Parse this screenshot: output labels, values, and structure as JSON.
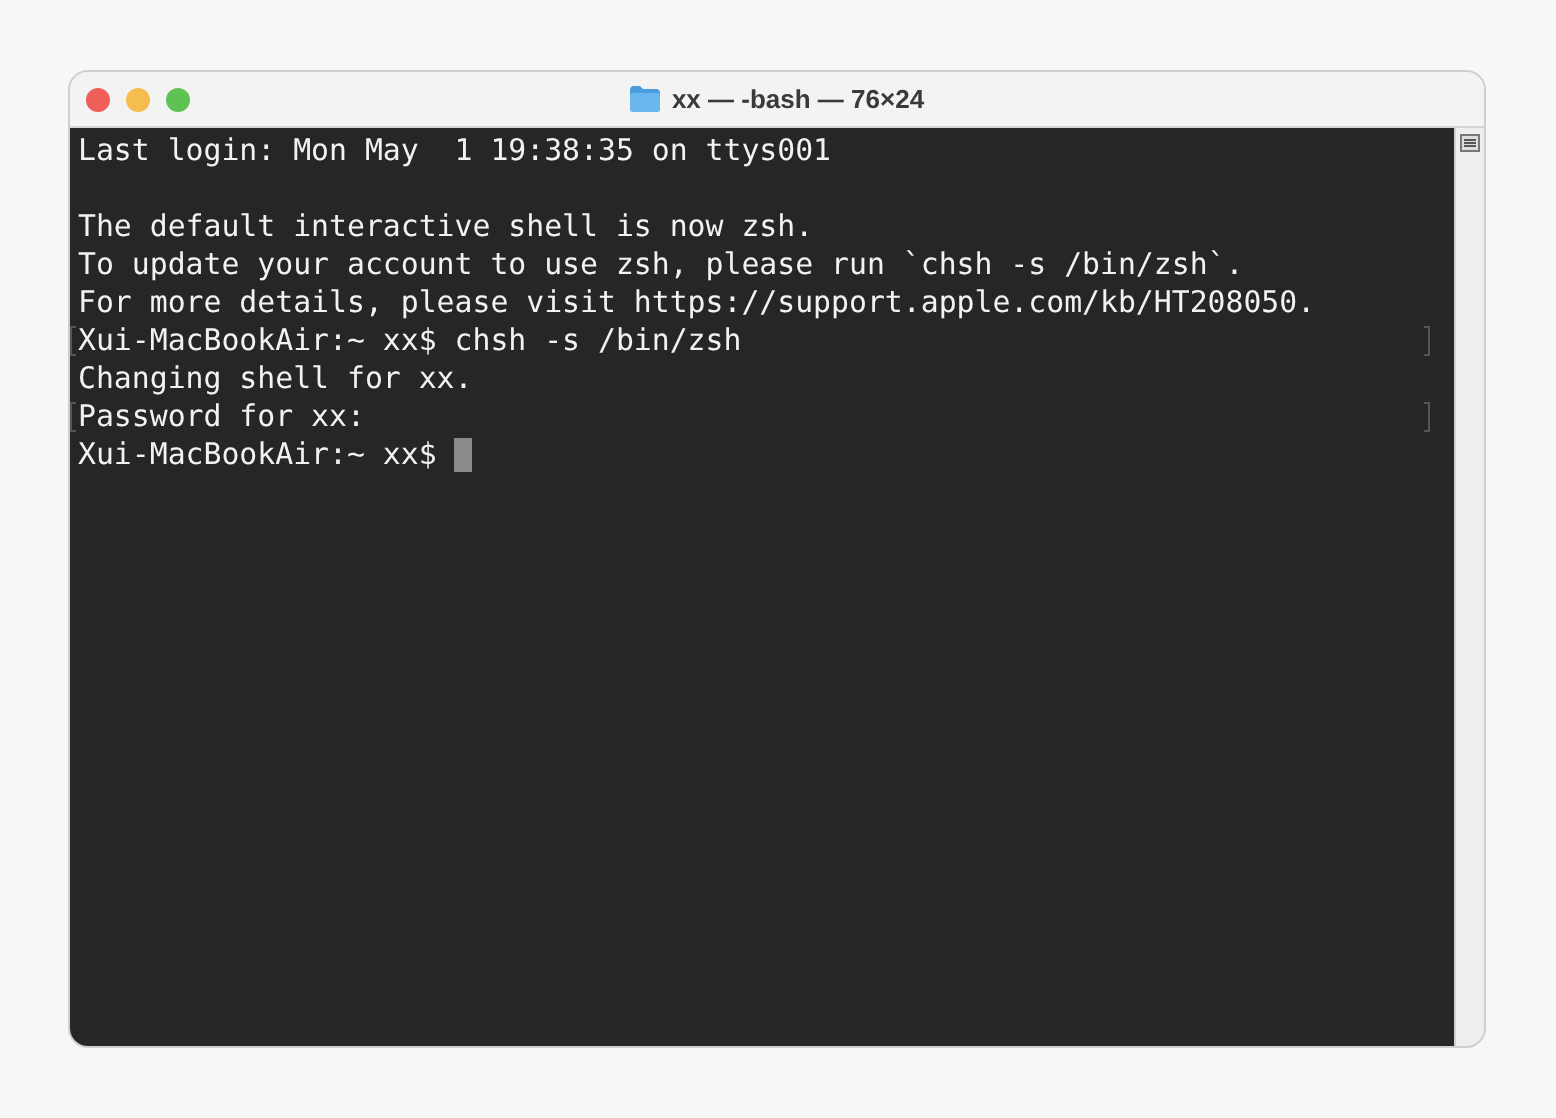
{
  "window": {
    "title": "xx — -bash — 76×24"
  },
  "terminal": {
    "lines": [
      {
        "kind": "text",
        "text": "Last login: Mon May  1 19:38:35 on ttys001",
        "marked": false,
        "cursor": false
      },
      {
        "kind": "blank"
      },
      {
        "kind": "text",
        "text": "The default interactive shell is now zsh.",
        "marked": false,
        "cursor": false
      },
      {
        "kind": "text",
        "text": "To update your account to use zsh, please run `chsh -s /bin/zsh`.",
        "marked": false,
        "cursor": false
      },
      {
        "kind": "text",
        "text": "For more details, please visit https://support.apple.com/kb/HT208050.",
        "marked": false,
        "cursor": false
      },
      {
        "kind": "text",
        "text": "Xui-MacBookAir:~ xx$ chsh -s /bin/zsh",
        "marked": true,
        "cursor": false
      },
      {
        "kind": "text",
        "text": "Changing shell for xx.",
        "marked": false,
        "cursor": false
      },
      {
        "kind": "text",
        "text": "Password for xx:",
        "marked": true,
        "cursor": false
      },
      {
        "kind": "text",
        "text": "Xui-MacBookAir:~ xx$",
        "marked": false,
        "cursor": true
      }
    ]
  }
}
